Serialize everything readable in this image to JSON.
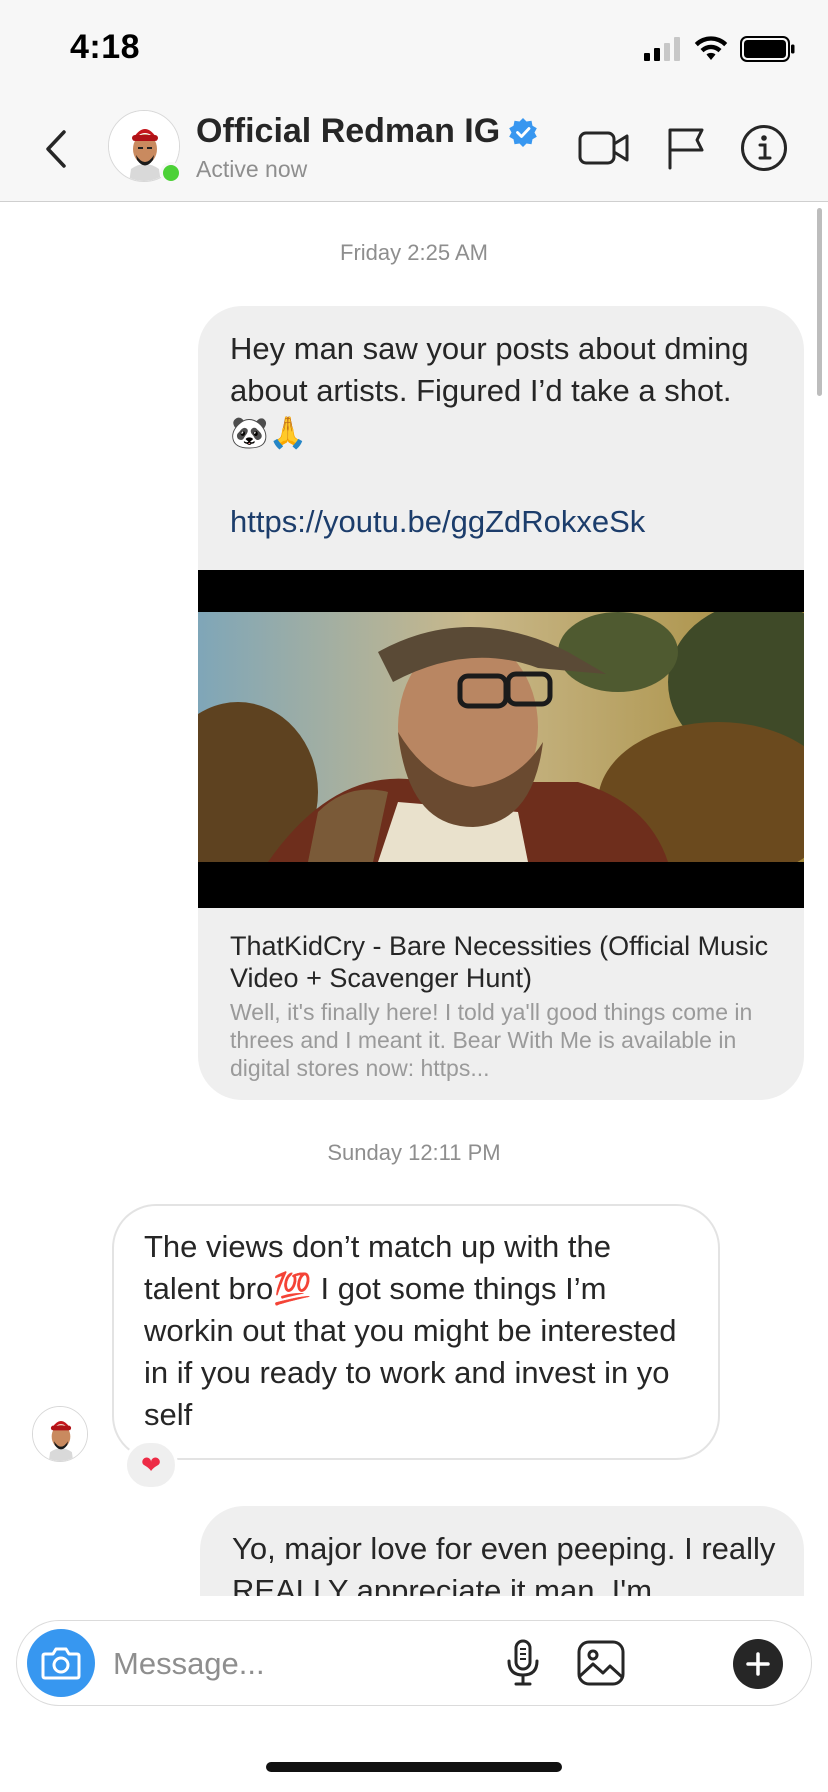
{
  "status_bar": {
    "time": "4:18",
    "icons": [
      "cellular-signal-icon",
      "wifi-icon",
      "battery-icon"
    ]
  },
  "header": {
    "name": "Official Redman IG",
    "verified": true,
    "status": "Active now",
    "icons": [
      "back-chevron-icon",
      "video-call-icon",
      "flag-icon",
      "info-icon"
    ]
  },
  "chat": {
    "timestamp_1": "Friday 2:25 AM",
    "message_1": {
      "text": "Hey man saw your posts about dming about artists. Figured I’d take a shot. 🐼🙏",
      "link": "https://youtu.be/ggZdRokxeSk",
      "preview_title": "ThatKidCry - Bare Necessities (Official Music Video + Scavenger Hunt)",
      "preview_desc": "Well, it's finally here! I told ya'll good things come in threes and I meant it. Bear With Me is available in digital stores now: https..."
    },
    "timestamp_2": "Sunday 12:11 PM",
    "message_2": {
      "text": "The views don’t match up with the talent bro💯 I got some things I’m workin out that you might be interested in if you ready to work and invest in yo self",
      "reaction": "❤"
    },
    "message_3": {
      "text": "Yo, major love for even peeping. I really REALLY appreciate it man. I'm"
    }
  },
  "composer": {
    "placeholder": "Message...",
    "icons": [
      "camera-icon",
      "microphone-icon",
      "gallery-icon",
      "plus-icon"
    ]
  },
  "colors": {
    "verified_blue": "#3897f0",
    "online_green": "#4cd137",
    "camera_button": "#3797f0",
    "link_color": "#1c3d6b",
    "heart": "#ed2b45"
  }
}
